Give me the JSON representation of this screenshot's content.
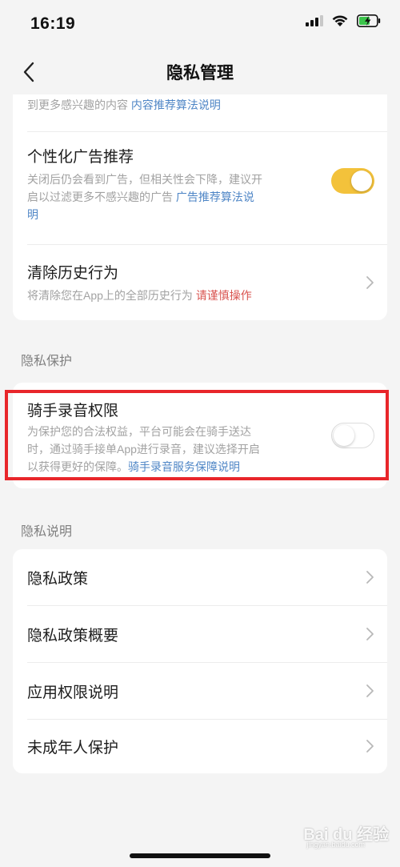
{
  "status": {
    "time": "16:19"
  },
  "nav": {
    "title": "隐私管理"
  },
  "top_card": {
    "partial_row": {
      "desc_text": "到更多感兴趣的内容 ",
      "desc_link": "内容推荐算法说明",
      "toggle_on": true
    },
    "ad_row": {
      "title": "个性化广告推荐",
      "desc_line1": "关闭后仍会看到广告，但相关性会下降，建议开",
      "desc_line2_text": "启以过滤更多不感兴趣的广告 ",
      "desc_link_part1": "广告推荐算法说",
      "desc_link_part2": "明",
      "toggle_on": true
    },
    "history_row": {
      "title": "清除历史行为",
      "desc_text": "将清除您在App上的全部历史行为 ",
      "desc_warning": "请谨慎操作"
    }
  },
  "privacy_protection": {
    "section_label": "隐私保护",
    "rider_row": {
      "title": "骑手录音权限",
      "desc_line1": "为保护您的合法权益，平台可能会在骑手送达",
      "desc_line2": "时，通过骑手接单App进行录音，建议选择开启",
      "desc_line3_text": "以获得更好的保障。",
      "desc_link": "骑手录音服务保障说明",
      "toggle_on": false
    }
  },
  "privacy_info": {
    "section_label": "隐私说明",
    "items": [
      {
        "label": "隐私政策"
      },
      {
        "label": "隐私政策概要"
      },
      {
        "label": "应用权限说明"
      },
      {
        "label": "未成年人保护"
      }
    ]
  },
  "colors": {
    "accent_toggle": "#f3c23b",
    "link_blue": "#4f86c6",
    "warning_red": "#d9534f",
    "highlight_red": "#e8262a"
  },
  "watermark": {
    "text": "Bai du 经验",
    "sub": "jingyan.baidu.com"
  }
}
